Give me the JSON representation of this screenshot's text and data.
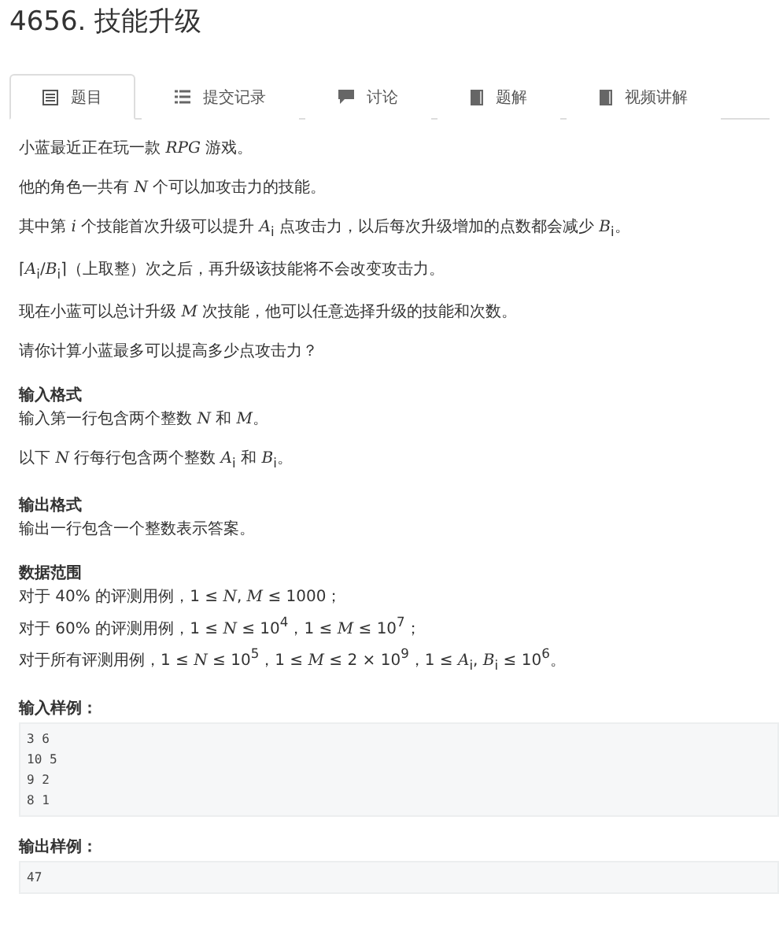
{
  "title": "4656. 技能升级",
  "tabs": [
    {
      "label": "题目",
      "kind": "doc",
      "selected": true
    },
    {
      "label": "提交记录",
      "kind": "list",
      "selected": false
    },
    {
      "label": "讨论",
      "kind": "chat",
      "selected": false
    },
    {
      "label": "题解",
      "kind": "book",
      "selected": false
    },
    {
      "label": "视频讲解",
      "kind": "book",
      "selected": false
    }
  ],
  "blocks": [
    {
      "kind": "para",
      "text": "小蓝最近正在玩一款 *RPG* 游戏。"
    },
    {
      "kind": "para",
      "text": "他的角色一共有 *N* 个可以加攻击力的技能。"
    },
    {
      "kind": "para",
      "text": "其中第 *i* 个技能首次升级可以提升 *A*$_{i}$ 点攻击力，以后每次升级增加的点数都会减少 *B*$_{i}$。"
    },
    {
      "kind": "para",
      "text": "⌈*A*$_{i}$/*B*$_{i}$⌉（上取整）次之后，再升级该技能将不会改变攻击力。"
    },
    {
      "kind": "para",
      "text": "现在小蓝可以总计升级 *M* 次技能，他可以任意选择升级的技能和次数。"
    },
    {
      "kind": "para",
      "text": "请你计算小蓝最多可以提高多少点攻击力？"
    },
    {
      "kind": "heading",
      "text": "输入格式"
    },
    {
      "kind": "para",
      "text": "输入第一行包含两个整数 *N* 和 *M*。"
    },
    {
      "kind": "para",
      "text": "以下 *N* 行每行包含两个整数 *A*$_{i}$ 和 *B*$_{i}$。"
    },
    {
      "kind": "heading",
      "text": "输出格式"
    },
    {
      "kind": "para",
      "text": "输出一行包含一个整数表示答案。"
    },
    {
      "kind": "heading",
      "text": "数据范围"
    },
    {
      "kind": "line",
      "text": "对于 40% 的评测用例，1 ≤ *N*, *M* ≤ 1000；"
    },
    {
      "kind": "line",
      "text": "对于 60% 的评测用例，1 ≤ *N* ≤ 10$^{4}$，1 ≤ *M* ≤ 10$^{7}$；"
    },
    {
      "kind": "para",
      "text": "对于所有评测用例，1 ≤ *N* ≤ 10$^{5}$，1 ≤ *M* ≤ 2 × 10$^{9}$，1 ≤ *A*$_{i}$, *B*$_{i}$ ≤ 10$^{6}$。"
    },
    {
      "kind": "heading",
      "text": "输入样例："
    },
    {
      "kind": "code",
      "lines": [
        "3 6",
        "10 5",
        "9 2",
        "8 1"
      ]
    },
    {
      "kind": "heading",
      "text": "输出样例："
    },
    {
      "kind": "code",
      "lines": [
        "47"
      ]
    }
  ]
}
